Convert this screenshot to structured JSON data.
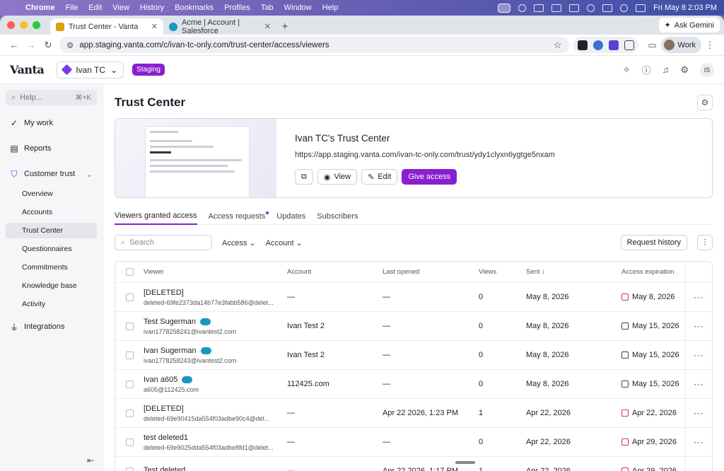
{
  "menubar": {
    "apple": "",
    "app": "Chrome",
    "items": [
      "File",
      "Edit",
      "View",
      "History",
      "Bookmarks",
      "Profiles",
      "Tab",
      "Window",
      "Help"
    ],
    "datetime": "Fri May 8  2:03 PM"
  },
  "tabs": [
    {
      "title": "Trust Center - Vanta",
      "active": true
    },
    {
      "title": "Acme | Account | Salesforce",
      "active": false
    }
  ],
  "ask_gemini": "Ask Gemini",
  "url": "app.staging.vanta.com/c/ivan-tc-only.com/trust-center/access/viewers",
  "profile": "Work",
  "app": {
    "logo": "Vanta",
    "workspace": "Ivan TC",
    "env": "Staging",
    "user_initials": "IS"
  },
  "sidebar": {
    "search_placeholder": "Help...",
    "shortcut": "⌘+K",
    "items": [
      {
        "label": "My work",
        "icon": "check-circle-icon"
      },
      {
        "label": "Reports",
        "icon": "report-icon"
      },
      {
        "label": "Customer trust",
        "icon": "shield-icon"
      }
    ],
    "sub_items": [
      "Overview",
      "Accounts",
      "Trust Center",
      "Questionnaires",
      "Commitments",
      "Knowledge base",
      "Activity"
    ],
    "selected": "Trust Center",
    "integrations": "Integrations"
  },
  "page": {
    "title": "Trust Center",
    "card": {
      "name": "Ivan TC's Trust Center",
      "url": "https://app.staging.vanta.com/ivan-tc-only.com/trust/ydy1clyxn6ygtge5nxam",
      "view": "View",
      "edit": "Edit",
      "give_access": "Give access"
    },
    "tabs": [
      "Viewers granted access",
      "Access requests",
      "Updates",
      "Subscribers"
    ],
    "search_placeholder": "Search",
    "filter_access": "Access",
    "filter_account": "Account",
    "request_history": "Request history"
  },
  "table": {
    "headers": [
      "Viewer",
      "Account",
      "Last opened",
      "Views",
      "Sent",
      "Access expiration"
    ],
    "rows": [
      {
        "name": "[DELETED]",
        "email": "deleted-69fe2373da14b77e3fabb586@delet...",
        "salesforce": false,
        "account": "—",
        "last_opened": "—",
        "views": "0",
        "sent": "May 8, 2026",
        "expiration": "May 8, 2026",
        "exp_red": true
      },
      {
        "name": "Test Sugerman",
        "email": "ivan1778258241@ivantest2.com",
        "salesforce": true,
        "account": "Ivan Test 2",
        "last_opened": "—",
        "views": "0",
        "sent": "May 8, 2026",
        "expiration": "May 15, 2026",
        "exp_red": false
      },
      {
        "name": "Ivan Sugerman",
        "email": "ivan1778258243@ivantest2.com",
        "salesforce": true,
        "account": "Ivan Test 2",
        "last_opened": "—",
        "views": "0",
        "sent": "May 8, 2026",
        "expiration": "May 15, 2026",
        "exp_red": false
      },
      {
        "name": "Ivan a605",
        "email": "a605@112425.com",
        "salesforce": true,
        "account": "112425.com",
        "last_opened": "—",
        "views": "0",
        "sent": "May 8, 2026",
        "expiration": "May 15, 2026",
        "exp_red": false
      },
      {
        "name": "[DELETED]",
        "email": "deleted-69e90415da554f03adbe90c4@del...",
        "salesforce": false,
        "account": "—",
        "last_opened": "Apr 22 2026, 1:23 PM",
        "views": "1",
        "sent": "Apr 22, 2026",
        "expiration": "Apr 22, 2026",
        "exp_red": true
      },
      {
        "name": "test deleted1",
        "email": "deleted-69e9025dda554f03adbe8fd1@delet...",
        "salesforce": false,
        "account": "—",
        "last_opened": "—",
        "views": "0",
        "sent": "Apr 22, 2026",
        "expiration": "Apr 29, 2026",
        "exp_red": true
      },
      {
        "name": "Test deleted",
        "email": "",
        "salesforce": false,
        "account": "—",
        "last_opened": "Apr 22 2026, 1:17 PM",
        "views": "1",
        "sent": "Apr 22, 2026",
        "expiration": "Apr 29, 2026",
        "exp_red": true
      }
    ]
  }
}
